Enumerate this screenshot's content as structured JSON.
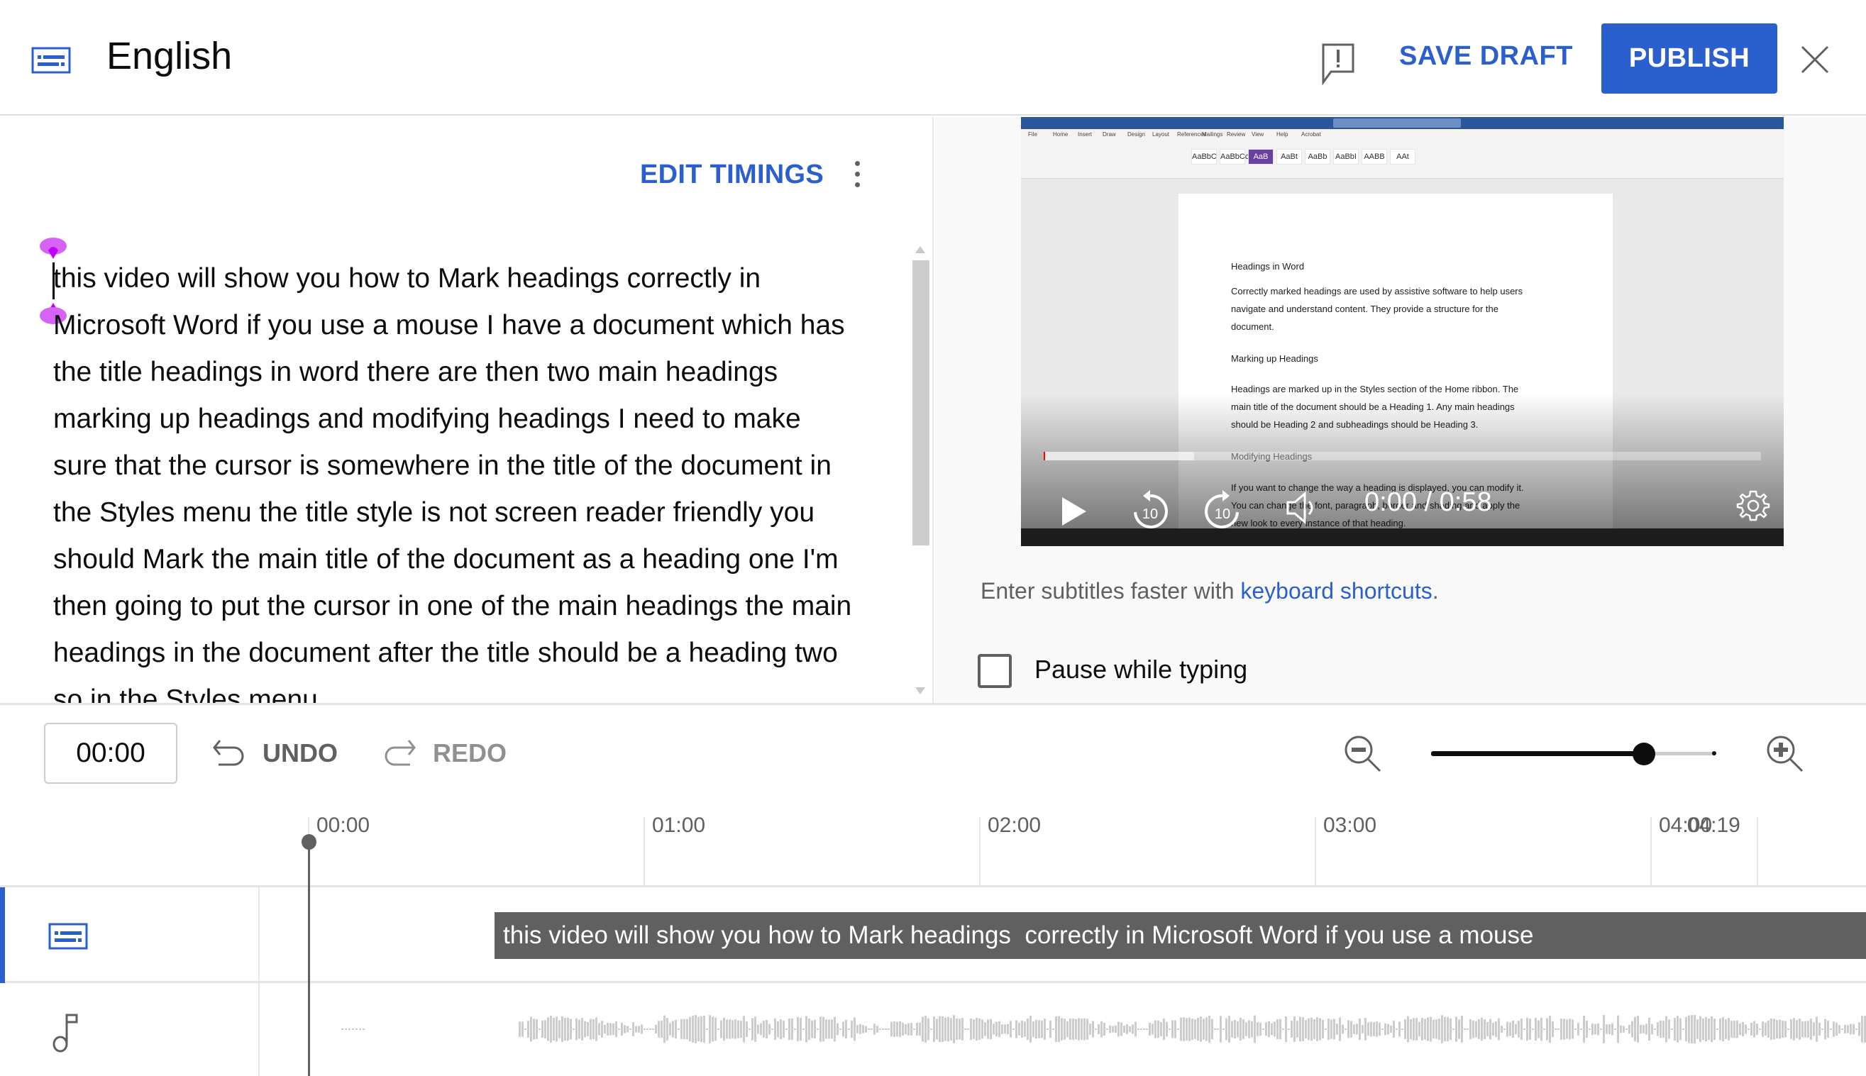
{
  "header": {
    "title": "English",
    "save_draft_label": "SAVE DRAFT",
    "publish_label": "PUBLISH",
    "icons": {
      "subtitles": "subtitles-icon",
      "feedback": "feedback-icon",
      "close": "close-icon"
    }
  },
  "editor": {
    "edit_timings_label": "EDIT TIMINGS",
    "transcript": "this video will show you how to Mark headings correctly in Microsoft Word if you use a mouse I have a document which has the title headings in word there are then two main headings marking up headings and modifying headings I need to make sure that the cursor is somewhere in the title of the document in the Styles menu the title style is not screen reader friendly you should Mark the main title of the document as a heading one I'm then going to put the cursor in one of the main headings the main headings in the document after the title should be a heading two so in the Styles menu"
  },
  "video": {
    "current_time": "0:00",
    "duration": "0:58",
    "time_display": "0:00 / 0:58",
    "played_fraction": 0.0,
    "buffered_fraction": 0.21,
    "controls": [
      "play-icon",
      "rewind-10-icon",
      "forward-10-icon",
      "volume-icon",
      "settings-icon"
    ],
    "frame": {
      "ribbon_tabs": [
        "File",
        "Home",
        "Insert",
        "Draw",
        "Design",
        "Layout",
        "References",
        "Mailings",
        "Review",
        "View",
        "Help",
        "Acrobat"
      ],
      "styles": [
        "AaBbC",
        "AaBbCcD",
        "AaB",
        "AaBt",
        "AaBb",
        "AaBbI",
        "AABB",
        "AAt"
      ],
      "doc_lines": [
        "Headings in Word",
        "Correctly marked headings are used by assistive software to help users",
        "navigate and understand content. They provide a structure for the",
        "document.",
        "Marking up Headings",
        "Headings are marked up in the Styles section of the Home ribbon. The",
        "main title of the document should be a Heading 1. Any main headings",
        "should be Heading 2 and subheadings should be Heading 3.",
        "Modifying Headings",
        "If you want to change the way a heading is displayed, you can modify it.",
        "You can change the font, paragraph, border and shading and apply the",
        "new look to every instance of that heading."
      ]
    }
  },
  "hint": {
    "prefix": "Enter subtitles faster with ",
    "link": "keyboard shortcuts",
    "suffix": "."
  },
  "pause_while_typing": {
    "label": "Pause while typing",
    "checked": false
  },
  "toolbar": {
    "time_value": "00:00",
    "undo_label": "UNDO",
    "redo_label": "REDO",
    "zoom_level": 0.75
  },
  "timeline": {
    "ticks": [
      "00:00",
      "01:00",
      "02:00",
      "03:00",
      "04:00"
    ],
    "end_label": "04:19",
    "playhead_time": "00:00",
    "caption_text": "this video will show you how to Mark headings  correctly in Microsoft Word if you use a mouse",
    "caption_start_seconds": 17
  },
  "colors": {
    "accent": "#2b5fce",
    "caption_bg": "#606060",
    "waveform": "#cccccc",
    "panel_bg": "#f9f9f9"
  }
}
